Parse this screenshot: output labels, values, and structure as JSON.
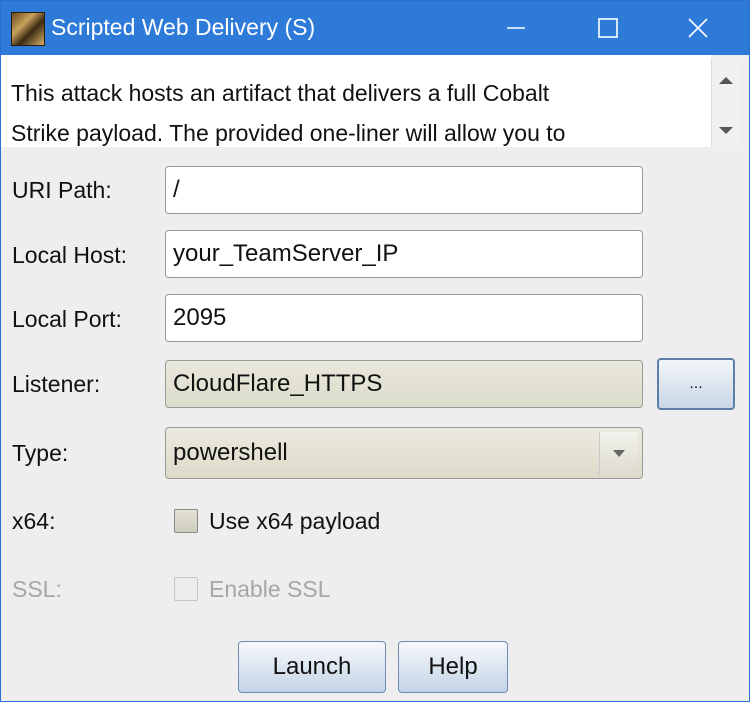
{
  "window": {
    "title": "Scripted Web Delivery (S)"
  },
  "description": {
    "line1": "This attack hosts an artifact that delivers a full Cobalt",
    "line2": "Strike payload. The provided one-liner will allow you to"
  },
  "form": {
    "uri_path": {
      "label": "URI Path:",
      "value": "/"
    },
    "local_host": {
      "label": "Local Host:",
      "value": "your_TeamServer_IP"
    },
    "local_port": {
      "label": "Local Port:",
      "value": "2095"
    },
    "listener": {
      "label": "Listener:",
      "value": "CloudFlare_HTTPS",
      "browse_label": "..."
    },
    "type": {
      "label": "Type:",
      "selected": "powershell"
    },
    "x64": {
      "label": "x64:",
      "checkbox_label": "Use x64 payload",
      "checked": false
    },
    "ssl": {
      "label": "SSL:",
      "checkbox_label": "Enable SSL",
      "checked": false,
      "enabled": false
    }
  },
  "buttons": {
    "launch": "Launch",
    "help": "Help"
  },
  "colors": {
    "titlebar": "#2d7ad9",
    "window_bg": "#eeeeee"
  }
}
